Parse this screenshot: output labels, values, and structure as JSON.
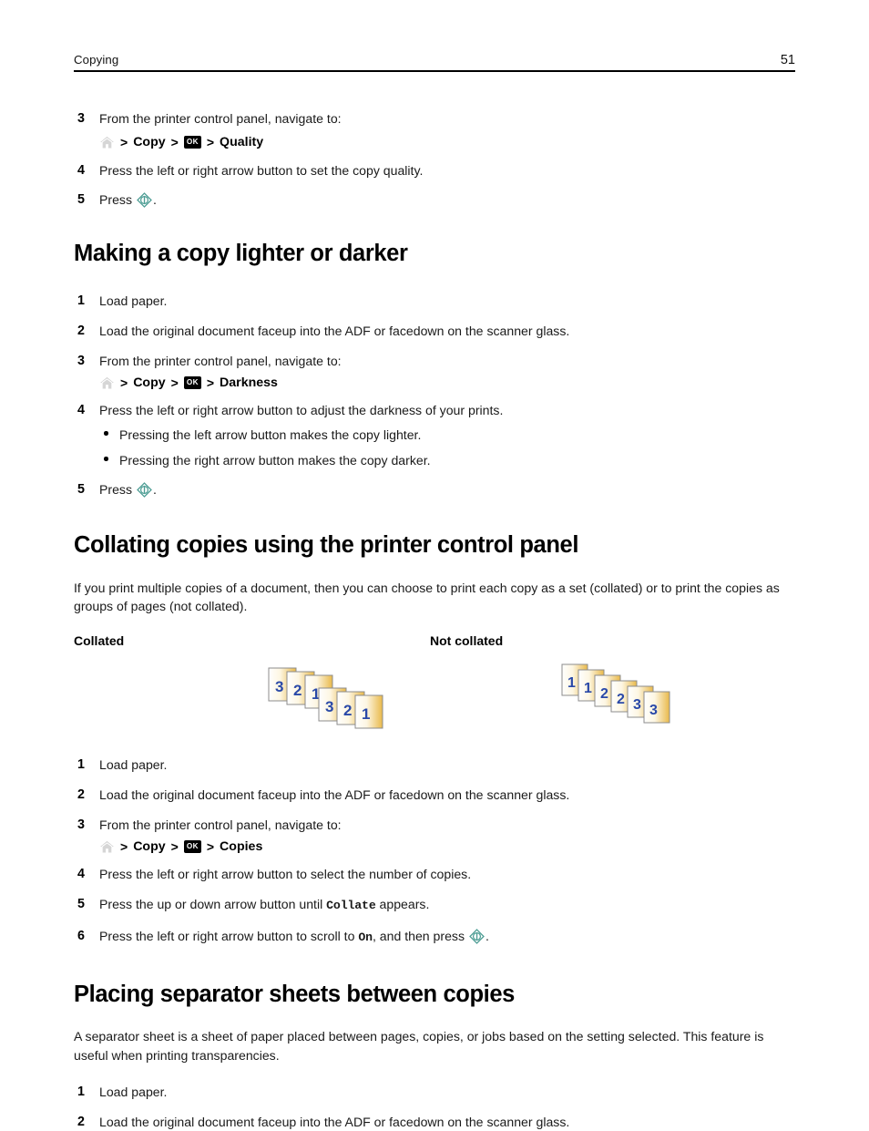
{
  "header": {
    "title": "Copying",
    "page_number": "51"
  },
  "icons": {
    "home": "home-icon",
    "ok_button": "OK",
    "start_button": "start-icon"
  },
  "separators": {
    "arrow": ">"
  },
  "sections": [
    {
      "id": "quality-tail",
      "heading": null,
      "steps": [
        {
          "num": "3",
          "text": "From the printer control panel, navigate to:",
          "navline": {
            "items": [
              "home",
              "Copy",
              "ok",
              "Quality"
            ]
          }
        },
        {
          "num": "4",
          "text": "Press the left or right arrow button to set the copy quality."
        },
        {
          "num": "5",
          "text_before": "Press ",
          "icon": "start",
          "text_after": "."
        }
      ]
    },
    {
      "id": "lighter-darker",
      "heading": "Making a copy lighter or darker",
      "steps": [
        {
          "num": "1",
          "text": "Load paper."
        },
        {
          "num": "2",
          "text": "Load the original document faceup into the ADF or facedown on the scanner glass."
        },
        {
          "num": "3",
          "text": "From the printer control panel, navigate to:",
          "navline": {
            "items": [
              "home",
              "Copy",
              "ok",
              "Darkness"
            ]
          }
        },
        {
          "num": "4",
          "text": "Press the left or right arrow button to adjust the darkness of your prints.",
          "bullets": [
            "Pressing the left arrow button makes the copy lighter.",
            "Pressing the right arrow button makes the copy darker."
          ]
        },
        {
          "num": "5",
          "text_before": "Press ",
          "icon": "start",
          "text_after": "."
        }
      ]
    },
    {
      "id": "collating",
      "heading": "Collating copies using the printer control panel",
      "intro": "If you print multiple copies of a document, then you can choose to print each copy as a set (collated) or to print the copies as groups of pages (not collated).",
      "figure": {
        "collated_label": "Collated",
        "not_collated_label": "Not collated",
        "collated_sequence": [
          "3",
          "2",
          "1",
          "3",
          "2",
          "1"
        ],
        "not_collated_sequence": [
          "1",
          "1",
          "2",
          "2",
          "3",
          "3"
        ]
      },
      "steps": [
        {
          "num": "1",
          "text": "Load paper."
        },
        {
          "num": "2",
          "text": "Load the original document faceup into the ADF or facedown on the scanner glass."
        },
        {
          "num": "3",
          "text": "From the printer control panel, navigate to:",
          "navline": {
            "items": [
              "home",
              "Copy",
              "ok",
              "Copies"
            ]
          }
        },
        {
          "num": "4",
          "text": "Press the left or right arrow button to select the number of copies."
        },
        {
          "num": "5",
          "text_before": "Press the up or down arrow button until ",
          "mono": "Collate",
          "text_after": " appears."
        },
        {
          "num": "6",
          "text_before": "Press the left or right arrow button to scroll to ",
          "mono": "On",
          "text_mid": ", and then press ",
          "icon": "start",
          "text_after": "."
        }
      ]
    },
    {
      "id": "separator-sheets",
      "heading": "Placing separator sheets between copies",
      "intro": "A separator sheet is a sheet of paper placed between pages, copies, or jobs based on the setting selected. This feature is useful when printing transparencies.",
      "steps": [
        {
          "num": "1",
          "text": "Load paper."
        },
        {
          "num": "2",
          "text": "Load the original document faceup into the ADF or facedown on the scanner glass."
        }
      ]
    }
  ],
  "colors": {
    "start_icon_teal": "#4e9e95",
    "page_number_blue": "#2244aa",
    "page_gold": "#e8b84a",
    "home_icon_gray": "#c9c9c9",
    "rule_black": "#000000"
  }
}
